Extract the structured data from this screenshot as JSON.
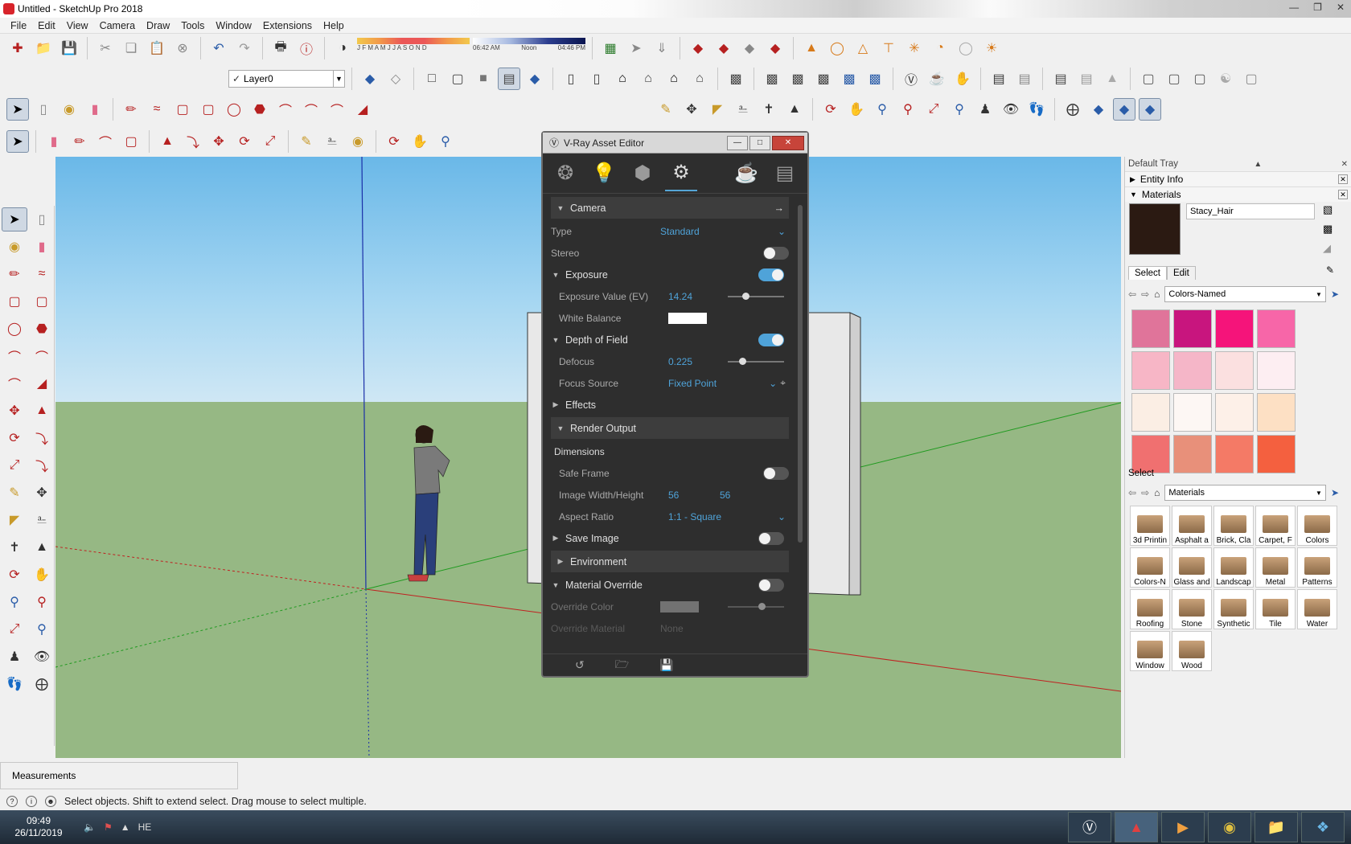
{
  "window": {
    "title": "Untitled - SketchUp Pro 2018"
  },
  "menu": [
    "File",
    "Edit",
    "View",
    "Camera",
    "Draw",
    "Tools",
    "Window",
    "Extensions",
    "Help"
  ],
  "toolbar": {
    "layer": "Layer0",
    "shadow_months": "J F M A M J J A S O N D",
    "time_start": "06:42 AM",
    "time_noon": "Noon",
    "time_end": "04:46 PM"
  },
  "vray": {
    "title": "V-Ray Asset Editor",
    "camera_section": "Camera",
    "type_label": "Type",
    "type_value": "Standard",
    "stereo_label": "Stereo",
    "exposure_section": "Exposure",
    "exposure_value_label": "Exposure Value (EV)",
    "exposure_value": "14.24",
    "white_balance_label": "White Balance",
    "dof_section": "Depth of Field",
    "defocus_label": "Defocus",
    "defocus_value": "0.225",
    "focus_source_label": "Focus Source",
    "focus_source_value": "Fixed Point",
    "effects_section": "Effects",
    "render_output_section": "Render Output",
    "dimensions_label": "Dimensions",
    "safe_frame_label": "Safe Frame",
    "image_wh_label": "Image Width/Height",
    "image_width": "56",
    "image_height": "56",
    "aspect_ratio_label": "Aspect Ratio",
    "aspect_ratio_value": "1:1 - Square",
    "save_image_section": "Save Image",
    "environment_section": "Environment",
    "material_override_section": "Material Override",
    "override_color_label": "Override Color",
    "override_material_label": "Override Material",
    "override_material_value": "None"
  },
  "tray": {
    "title": "Default Tray",
    "entity_info": "Entity Info",
    "materials": "Materials",
    "material_name": "Stacy_Hair",
    "tab_select": "Select",
    "tab_edit": "Edit",
    "collection": "Colors-Named",
    "color_swatches": [
      "#e0749a",
      "#c8157e",
      "#f5147a",
      "#f766a8",
      "#f7b6c6",
      "#f5b6c8",
      "#fbe0e0",
      "#fdeef2",
      "#fbeee4",
      "#fdf7f4",
      "#fdf0e8",
      "#fde0c4",
      "#f07070",
      "#e8907a",
      "#f47a66",
      "#f4603f"
    ],
    "select_label": "Select",
    "library": "Materials",
    "library_items": [
      "3d Printin",
      "Asphalt a",
      "Brick, Cla",
      "Carpet, F",
      "Colors",
      "Colors-N",
      "Glass and",
      "Landscap",
      "Metal",
      "Patterns",
      "Roofing",
      "Stone",
      "Synthetic",
      "Tile",
      "Water",
      "Window",
      "Wood"
    ]
  },
  "measurements_label": "Measurements",
  "status_text": "Select objects. Shift to extend select. Drag mouse to select multiple.",
  "taskbar": {
    "time": "09:49",
    "date": "26/11/2019",
    "lang": "HE"
  }
}
